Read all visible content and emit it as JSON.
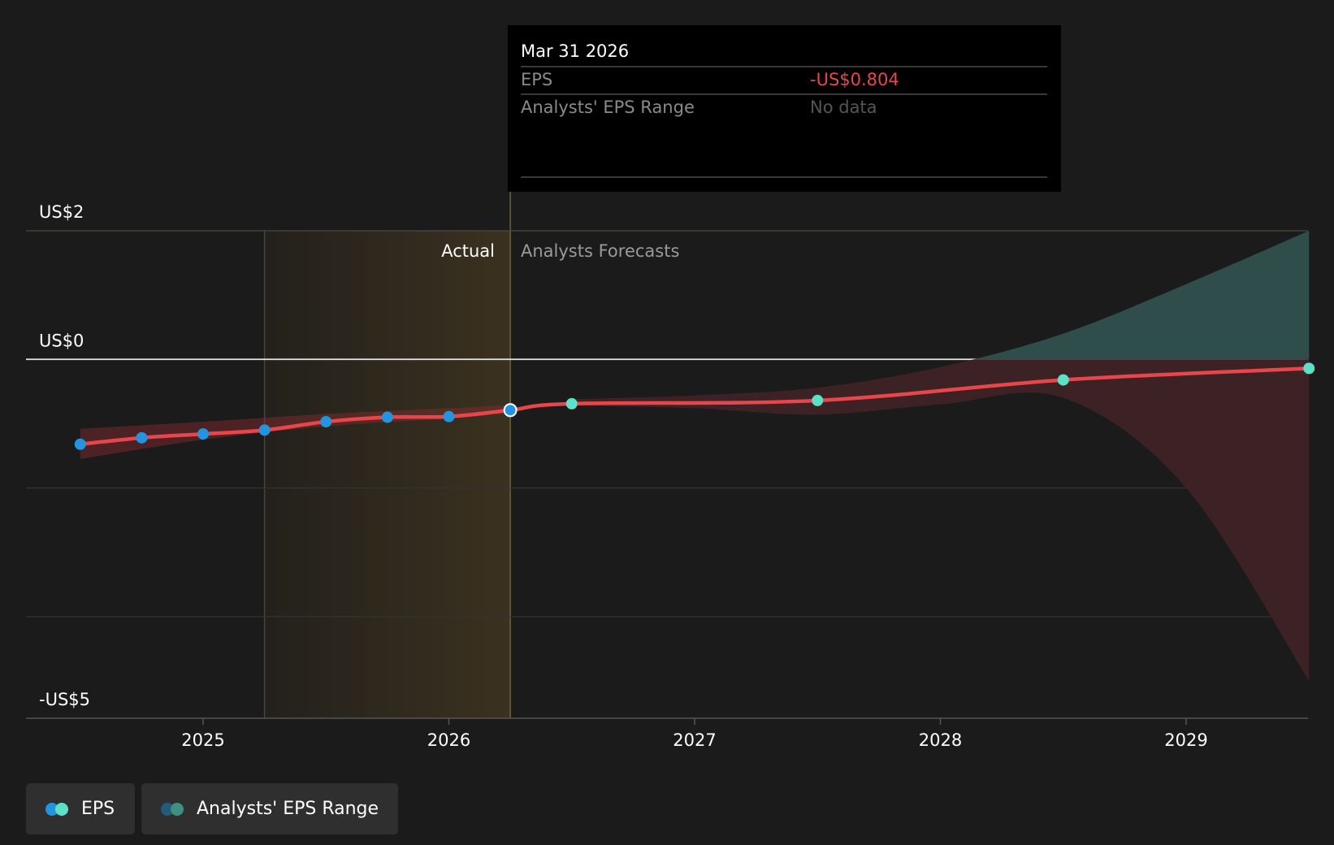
{
  "tooltip": {
    "date": "Mar 31 2026",
    "eps_label": "EPS",
    "eps_value": "-US$0.804",
    "range_label": "Analysts' EPS Range",
    "range_value": "No data"
  },
  "labels": {
    "actual": "Actual",
    "forecasts": "Analysts Forecasts"
  },
  "legend": {
    "eps": "EPS",
    "range": "Analysts' EPS Range"
  },
  "colors": {
    "background": "#1b1b1b",
    "eps_line": "#e8464a",
    "actual_dot": "#2394df",
    "forecast_dot": "#5ce1c8",
    "range_pos": "#2f4e4b",
    "range_neg": "#3d2225",
    "actual_band": "#3b311f"
  },
  "chart_data": {
    "type": "line",
    "title": "",
    "y_axis": {
      "min": -5,
      "max": 2,
      "tick_labels": [
        "US$2",
        "US$0",
        "-US$5"
      ],
      "tick_values": [
        2,
        0,
        -5
      ],
      "grid_values": [
        2,
        0,
        -2,
        -4
      ]
    },
    "x_axis": {
      "min": 2024.28,
      "max": 2029.5,
      "tick_labels": [
        "2025",
        "2026",
        "2027",
        "2028",
        "2029"
      ],
      "tick_values": [
        2025,
        2026,
        2027,
        2028,
        2029
      ]
    },
    "actual_region": [
      2025.25,
      2026.25
    ],
    "series": [
      {
        "name": "EPS",
        "points": [
          {
            "x": 2024.5,
            "y": -1.32,
            "kind": "actual"
          },
          {
            "x": 2024.75,
            "y": -1.22,
            "kind": "actual"
          },
          {
            "x": 2025.0,
            "y": -1.16,
            "kind": "actual"
          },
          {
            "x": 2025.25,
            "y": -1.1,
            "kind": "actual"
          },
          {
            "x": 2025.5,
            "y": -0.97,
            "kind": "actual"
          },
          {
            "x": 2025.75,
            "y": -0.9,
            "kind": "actual"
          },
          {
            "x": 2026.0,
            "y": -0.89,
            "kind": "actual"
          },
          {
            "x": 2026.25,
            "y": -0.79,
            "kind": "actual"
          },
          {
            "x": 2026.5,
            "y": -0.69,
            "kind": "forecast"
          },
          {
            "x": 2027.5,
            "y": -0.64,
            "kind": "forecast"
          },
          {
            "x": 2028.5,
            "y": -0.32,
            "kind": "forecast"
          },
          {
            "x": 2029.5,
            "y": -0.14,
            "kind": "forecast"
          }
        ]
      }
    ],
    "historic_range": {
      "x": [
        2024.5,
        2025.0,
        2025.5,
        2026.0,
        2026.25
      ],
      "upper": [
        -1.08,
        -0.97,
        -0.85,
        -0.76,
        -0.71
      ],
      "lower": [
        -1.55,
        -1.25,
        -1.04,
        -0.92,
        -0.84
      ]
    },
    "forecast_range": {
      "x": [
        2026.5,
        2027.0,
        2027.5,
        2028.0,
        2028.5,
        2029.0,
        2029.5
      ],
      "upper": [
        -0.62,
        -0.56,
        -0.44,
        -0.12,
        0.4,
        1.17,
        2.0
      ],
      "lower": [
        -0.72,
        -0.76,
        -0.86,
        -0.7,
        -0.6,
        -2.0,
        -5.0
      ]
    },
    "highlighted_point": {
      "x": 2026.25,
      "y": -0.804
    }
  }
}
